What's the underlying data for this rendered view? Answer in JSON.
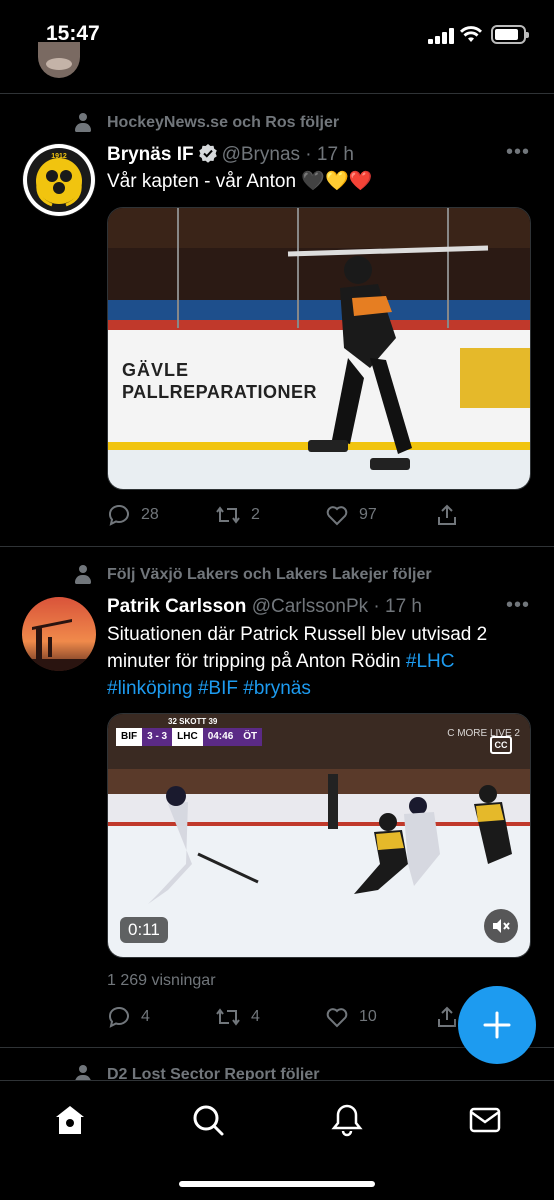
{
  "status_bar": {
    "time": "15:47"
  },
  "tweets": [
    {
      "social_context": "HockeyNews.se och Ros följer",
      "author_name": "Brynäs IF",
      "handle": "@Brynas",
      "time": "17 h",
      "avatar_text": "1912",
      "text": "Vår kapten - vår Anton 🖤💛❤️",
      "media_board_line1": "GÄVLE",
      "media_board_line2": "PALLREPARATIONER",
      "replies": "28",
      "retweets": "2",
      "likes": "97"
    },
    {
      "social_context": "Följ Växjö Lakers och Lakers Lakejer följer",
      "author_name": "Patrik Carlsson",
      "handle": "@CarlssonPk",
      "time": "17 h",
      "text_plain": "Situationen där Patrick Russell blev utvisad 2 minuter för tripping på Anton Rödin ",
      "hashtags": [
        "#LHC",
        "#linköping",
        "#BIF",
        "#brynäs"
      ],
      "scorebug": {
        "shots": "32 SKOTT 39",
        "home": "BIF",
        "score": "3 - 3",
        "away": "LHC",
        "clock": "04:46",
        "period": "ÖT"
      },
      "broadcaster": "C MORE LIVE 2",
      "cc_label": "CC",
      "video_duration": "0:11",
      "views": "1 269 visningar",
      "replies": "4",
      "retweets": "4",
      "likes": "10"
    }
  ],
  "next_tweet": {
    "social_context": "D2 Lost Sector Report följer"
  },
  "tab_bar": {
    "items": [
      "home-icon",
      "search-icon",
      "notifications-icon",
      "messages-icon"
    ]
  },
  "colors": {
    "accent": "#1d9bf0",
    "background": "#000000",
    "secondary_text": "#71767b"
  }
}
